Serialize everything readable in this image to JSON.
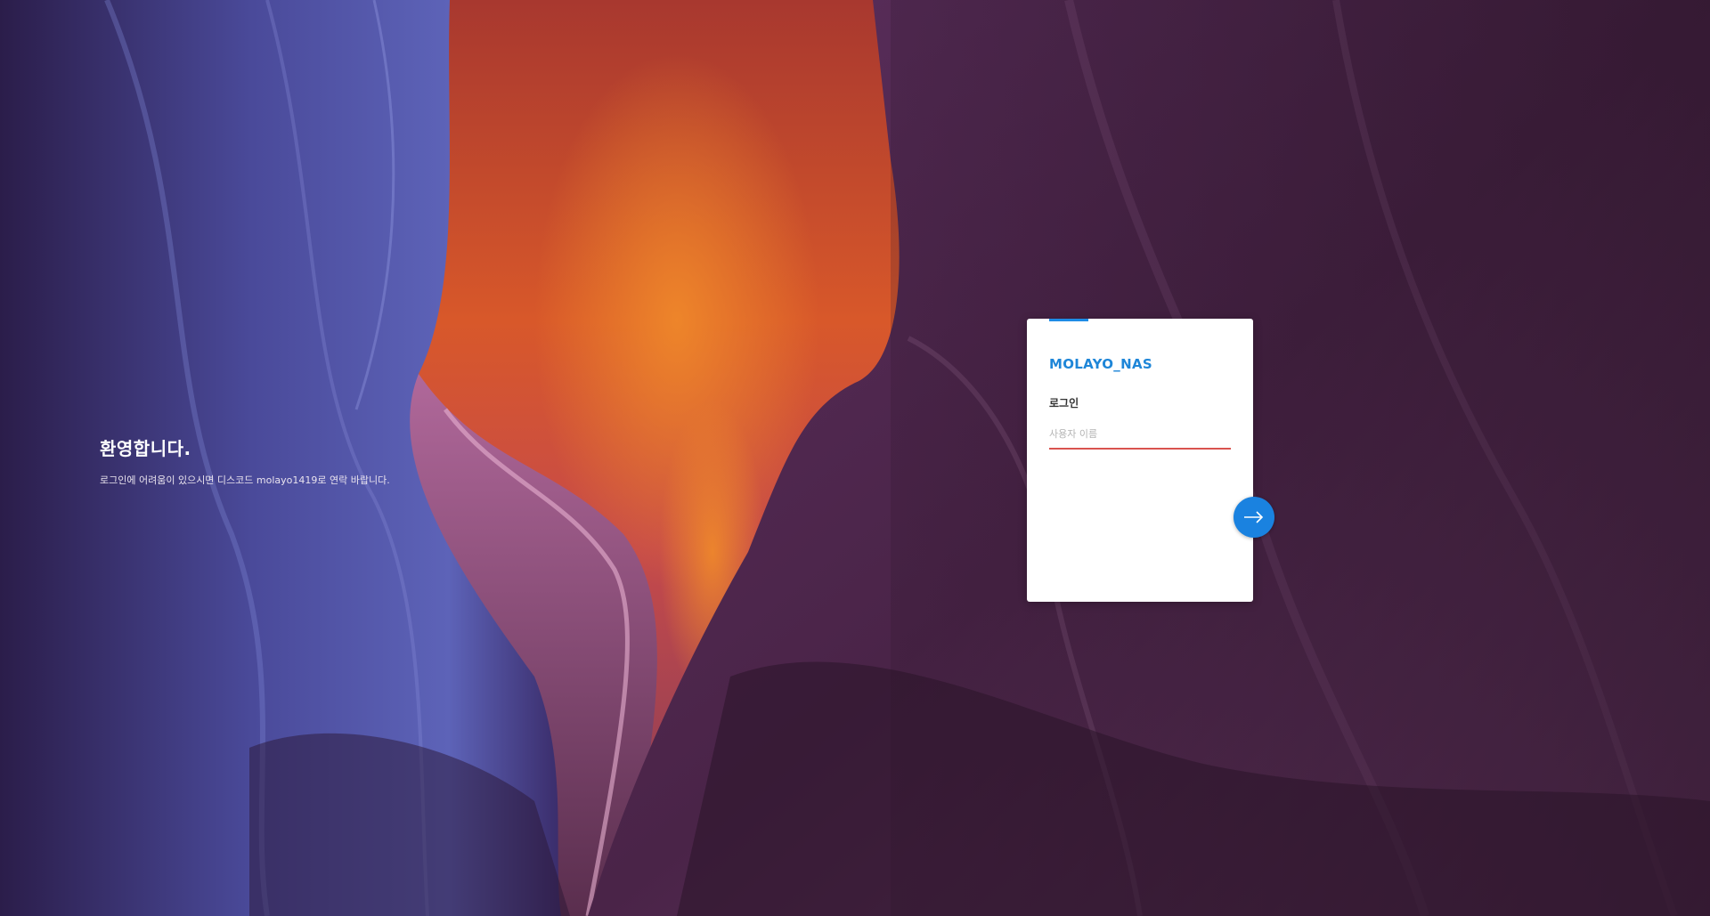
{
  "welcome": {
    "title": "환영합니다.",
    "subtitle": "로그인에 어려움이 있으시면 디스코드 molayo1419로 연락 바랍니다."
  },
  "login": {
    "server_name": "MOLAYO_NAS",
    "heading": "로그인",
    "username_placeholder": "사용자 이름",
    "username_value": "",
    "next_icon": "arrow-right-icon"
  },
  "colors": {
    "accent": "#1e86d8",
    "input_underline": "#d9534f",
    "button": "#1a82e0"
  }
}
